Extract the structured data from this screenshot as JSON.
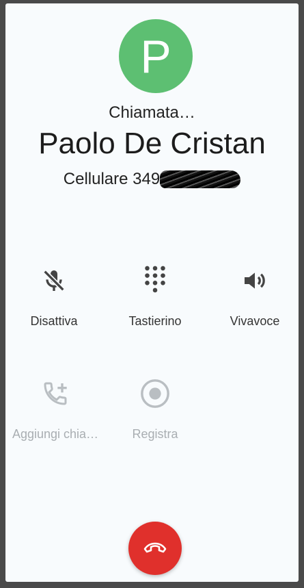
{
  "contact": {
    "initial": "P",
    "status": "Chiamata…",
    "name": "Paolo De Cristan",
    "number_label": "Cellulare 349"
  },
  "colors": {
    "avatar": "#5dbf72",
    "end_call": "#e0302c",
    "icon_active": "#444444",
    "icon_disabled": "#b9bec2"
  },
  "controls": {
    "mute_label": "Disattiva",
    "keypad_label": "Tastierino",
    "speaker_label": "Vivavoce",
    "add_call_label": "Aggiungi chia…",
    "record_label": "Registra"
  }
}
